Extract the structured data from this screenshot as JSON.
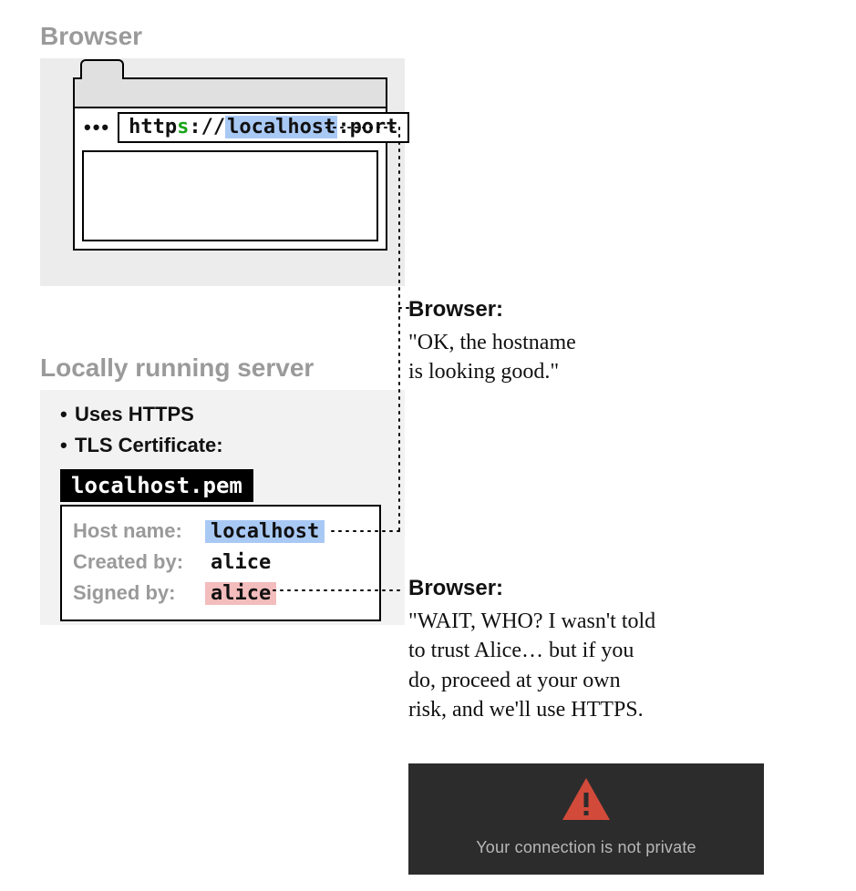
{
  "titles": {
    "browser": "Browser",
    "server": "Locally running server"
  },
  "address": {
    "scheme_prefix": "http",
    "scheme_s": "s",
    "sep": "://",
    "host": "localhost",
    "port_sep": ":",
    "port_word": "port"
  },
  "server": {
    "bullet1": "Uses HTTPS",
    "bullet2": "TLS Certificate:",
    "cert_filename": "localhost.pem",
    "rows": {
      "hostname_label": "Host name:",
      "hostname_value": "localhost",
      "created_label": "Created by:",
      "created_value": "alice",
      "signed_label": "Signed by:",
      "signed_value": "alice"
    }
  },
  "annotations": {
    "a1_title": "Browser:",
    "a1_text": "\"OK, the hostname\nis looking good.\"",
    "a2_title": "Browser:",
    "a2_text": "\"WAIT, WHO? I wasn't told\nto trust Alice… but if you\ndo, proceed at your own\nrisk, and we'll use HTTPS."
  },
  "warning": {
    "message": "Your connection is not private"
  }
}
